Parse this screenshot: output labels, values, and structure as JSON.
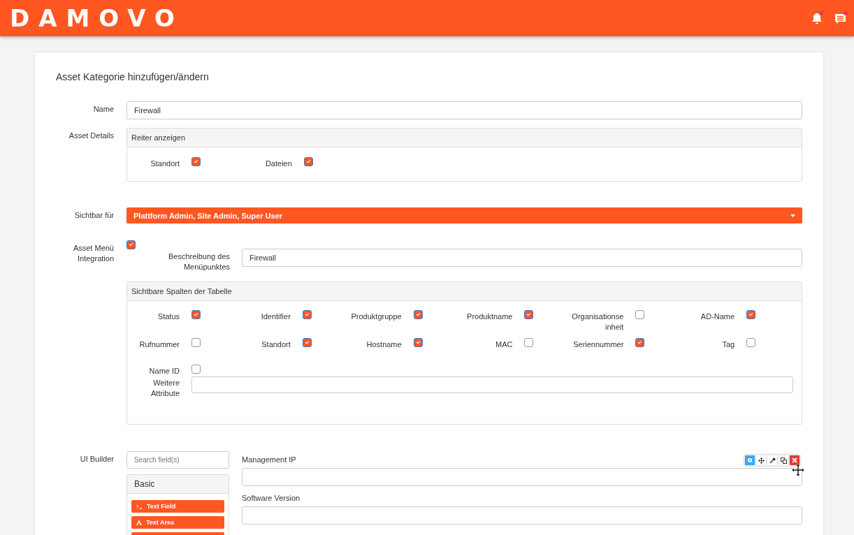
{
  "header": {
    "logo": "DAMOVO"
  },
  "title": "Asset Kategorie hinzufügen/ändern",
  "name": {
    "label": "Name",
    "value": "Firewall"
  },
  "asset_details": {
    "label": "Asset Details",
    "panel_title": "Reiter anzeigen",
    "options": [
      {
        "label": "Standort",
        "checked": true
      },
      {
        "label": "Dateien",
        "checked": true
      }
    ]
  },
  "visible_for": {
    "label": "Sichtbar für",
    "value": "Plattform Admin, Site Admin, Super User"
  },
  "asset_menu": {
    "label": "Asset Menü Integration",
    "checked": true,
    "description_label": "Beschreibung des Menüpunktes",
    "description_value": "Firewall",
    "columns_title": "Sichtbare Spalten der Tabelle",
    "columns": [
      {
        "label": "Status",
        "checked": true
      },
      {
        "label": "Identifier",
        "checked": true
      },
      {
        "label": "Produktgruppe",
        "checked": true
      },
      {
        "label": "Produktname",
        "checked": true
      },
      {
        "label": "Organisationseinheit",
        "checked": false
      },
      {
        "label": "AD-Name",
        "checked": true
      },
      {
        "label": "Rufnummer",
        "checked": false
      },
      {
        "label": "Standort",
        "checked": true
      },
      {
        "label": "Hostname",
        "checked": true
      },
      {
        "label": "MAC",
        "checked": false
      },
      {
        "label": "Seriennummer",
        "checked": true
      },
      {
        "label": "Tag",
        "checked": false
      },
      {
        "label": "Name ID",
        "checked": false
      }
    ],
    "more_label": "Weitere Attribute"
  },
  "ui_builder": {
    "label": "UI Builder",
    "search_placeholder": "Search field(s)",
    "group": "Basic",
    "field_types": [
      {
        "label": "Text Field",
        "kind": "prompt"
      },
      {
        "label": "Text Area",
        "kind": "letter"
      }
    ],
    "fields": [
      {
        "label": "Management IP",
        "toolbar": true
      },
      {
        "label": "Software Version",
        "toolbar": false
      }
    ]
  }
}
